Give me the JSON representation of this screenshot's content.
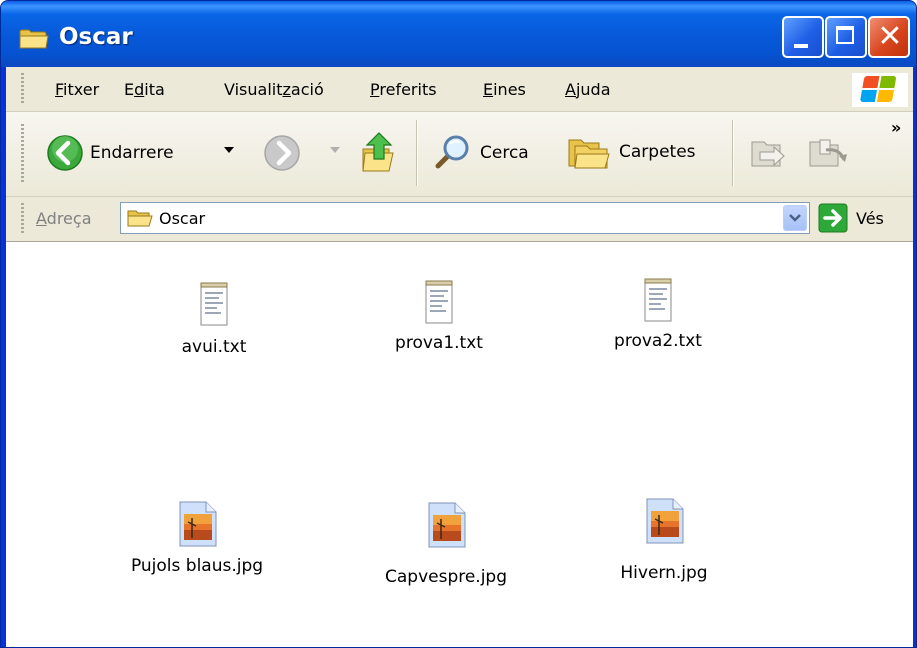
{
  "window": {
    "title": "Oscar",
    "folder_icon": "folder-icon",
    "close_glyph": "✕"
  },
  "menu": [
    {
      "text": "Fitxer",
      "key": "F"
    },
    {
      "text": "Edita",
      "key": "d"
    },
    {
      "text": "Visualització",
      "key": "z"
    },
    {
      "text": "Preferits",
      "key": "P"
    },
    {
      "text": "Eines",
      "key": "E"
    },
    {
      "text": "Ajuda",
      "key": "A"
    }
  ],
  "toolbar": {
    "back_label": "Endarrere",
    "search_label": "Cerca",
    "folders_label": "Carpetes",
    "chevron": "»"
  },
  "address": {
    "label": "Adreça",
    "value": "Oscar",
    "go_label": "Vés"
  },
  "files": [
    {
      "name": "avui.txt",
      "type": "text"
    },
    {
      "name": "prova1.txt",
      "type": "text"
    },
    {
      "name": "prova2.txt",
      "type": "text"
    },
    {
      "name": "Pujols blaus.jpg",
      "type": "image"
    },
    {
      "name": "Capvespre.jpg",
      "type": "image"
    },
    {
      "name": "Hivern.jpg",
      "type": "image"
    }
  ],
  "colors": {
    "titlebar": "#0758d8",
    "close_button": "#d8461e",
    "chrome": "#ece9d8",
    "file_area": "#ffffff"
  }
}
